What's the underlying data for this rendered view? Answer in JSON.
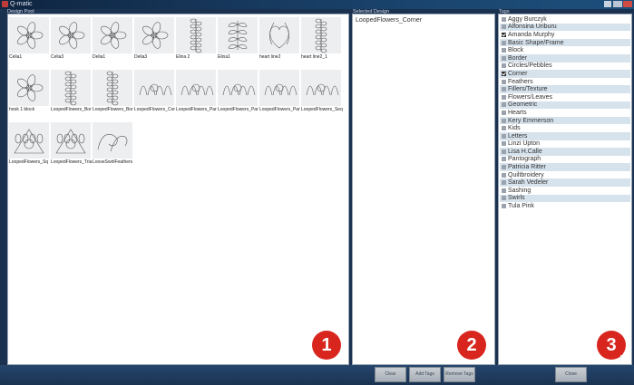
{
  "window": {
    "title": "Q-matic"
  },
  "design_pool": {
    "label": "Design Pool",
    "items": [
      {
        "name": "Celia1",
        "icon": "celia-flower-icon"
      },
      {
        "name": "Celia3",
        "icon": "celia-flower-icon"
      },
      {
        "name": "Delia1",
        "icon": "delia-flower-icon"
      },
      {
        "name": "Delia3",
        "icon": "delia-flower-icon"
      },
      {
        "name": "Elina 2",
        "icon": "border-vine-icon"
      },
      {
        "name": "Elina1",
        "icon": "leaf-branch-icon"
      },
      {
        "name": "heart line2",
        "icon": "heart-swirl-icon"
      },
      {
        "name": "heart line2_1",
        "icon": "heart-vine-icon"
      },
      {
        "name": "hook 1 block",
        "icon": "pinwheel-block-icon"
      },
      {
        "name": "LoopedFlowers_Bor",
        "icon": "looped-border-icon"
      },
      {
        "name": "LoopedFlowers_Bor",
        "icon": "looped-border-icon"
      },
      {
        "name": "LoopedFlowers_Cor",
        "icon": "looped-corner-icon"
      },
      {
        "name": "LoopedFlowers_Par",
        "icon": "looped-panel-icon"
      },
      {
        "name": "LoopedFlowers_Par",
        "icon": "looped-panel-icon"
      },
      {
        "name": "LoopedFlowers_Par",
        "icon": "looped-panel-icon"
      },
      {
        "name": "LoopedFlowers_Seq",
        "icon": "looped-sequence-icon"
      },
      {
        "name": "LoopedFlowers_Sq",
        "icon": "looped-square-icon"
      },
      {
        "name": "LoopedFlowers_Tria",
        "icon": "looped-triangle-icon"
      },
      {
        "name": "LooseSwirlFeathers",
        "icon": "swirl-feather-icon"
      }
    ]
  },
  "selected_design": {
    "label": "Selected Design",
    "value": "LoopedFlowers_Corner"
  },
  "tags": {
    "label": "Tags",
    "items": [
      {
        "label": "Aggy Burczyk",
        "checked": false
      },
      {
        "label": "Alfonsina Uriburu",
        "checked": false
      },
      {
        "label": "Amanda Murphy",
        "checked": true
      },
      {
        "label": "Basic Shape/Frame",
        "checked": false
      },
      {
        "label": "Block",
        "checked": false
      },
      {
        "label": "Border",
        "checked": false
      },
      {
        "label": "Circles/Pebbles",
        "checked": false
      },
      {
        "label": "Corner",
        "checked": true
      },
      {
        "label": "Feathers",
        "checked": false
      },
      {
        "label": "Fillers/Texture",
        "checked": false
      },
      {
        "label": "Flowers/Leaves",
        "checked": false
      },
      {
        "label": "Geometric",
        "checked": false
      },
      {
        "label": "Hearts",
        "checked": false
      },
      {
        "label": "Kery Emmerson",
        "checked": false
      },
      {
        "label": "Kids",
        "checked": false
      },
      {
        "label": "Letters",
        "checked": false
      },
      {
        "label": "Linzi Upton",
        "checked": false
      },
      {
        "label": "Lisa H.Calle",
        "checked": false
      },
      {
        "label": "Pantograph",
        "checked": false
      },
      {
        "label": "Patricia Ritter",
        "checked": false
      },
      {
        "label": "Quiltbroidery",
        "checked": false
      },
      {
        "label": "Sarah Vedeler",
        "checked": false
      },
      {
        "label": "Sashing",
        "checked": false
      },
      {
        "label": "Swirls",
        "checked": false
      },
      {
        "label": "Tula Pink",
        "checked": false
      }
    ]
  },
  "markers": [
    "1",
    "2",
    "3"
  ],
  "buttons": {
    "clear": "Clear",
    "add_tags": "Add Tags",
    "remove_tags": "Remove Tags",
    "close": "Close"
  },
  "colors": {
    "marker": "#d8261f",
    "tag_stripe": "#d6e2ec"
  }
}
